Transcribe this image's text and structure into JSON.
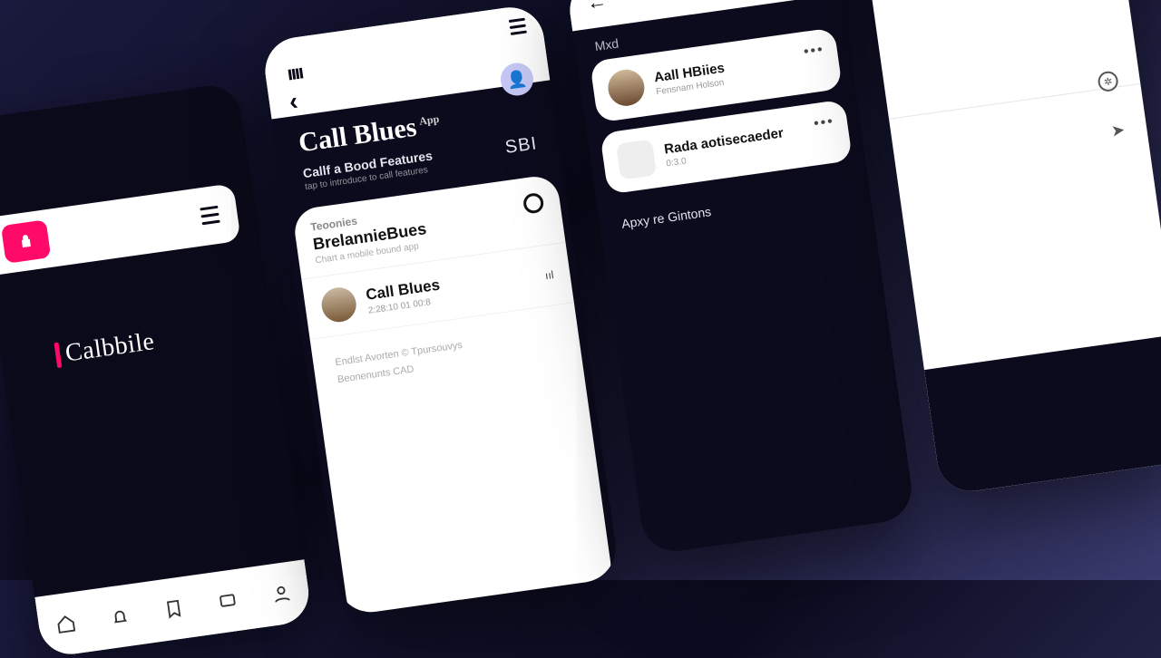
{
  "colors": {
    "bg_dark": "#0b0b1d",
    "accent": "#ff0a68",
    "lilac": "#c5c8f5"
  },
  "phone1": {
    "brand": "Calbbile",
    "nav": [
      "home-icon",
      "bell-icon",
      "bookmark-icon",
      "chat-icon",
      "profile-icon"
    ]
  },
  "phone2": {
    "signal_glyph": "ıııı",
    "title": "Call Blues",
    "title_sup": "App",
    "subtitle": "Callf a Bood Features",
    "subtitle_meta": "tap to introduce to call features",
    "sbi_label": "SBI",
    "card1": {
      "label": "Teoonies",
      "title": "BrelannieBues",
      "meta": "Chart a mobile bound app"
    },
    "row1": {
      "name": "Call Blues",
      "meta": "2:28:10 01 00:8",
      "signal": "ııl"
    },
    "para_line1": "Endlst Avorten  © Tpursouvys",
    "para_line2": "Beonenunts CAD"
  },
  "phone3": {
    "section1": "Mxd",
    "contact1": {
      "name": "Aall HBiies",
      "sub": "Fensnam Holson"
    },
    "contact2": {
      "name": "Rada aotisecaeder",
      "sub": "0:3.0"
    },
    "more_label": "Apxy re Gintons"
  },
  "phone4": {
    "icon1_name": "settings-icon",
    "icon2_name": "send-icon"
  }
}
